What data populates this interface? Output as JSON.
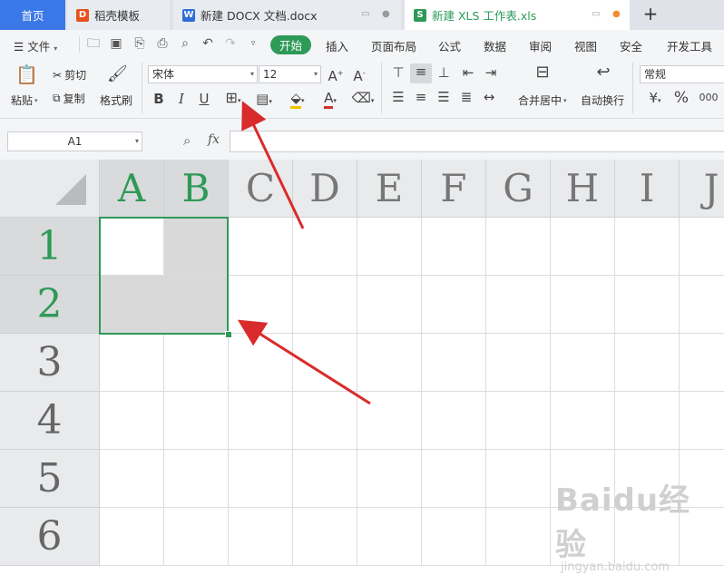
{
  "tabs": {
    "home": "首页",
    "daoke": {
      "label": "稻壳模板"
    },
    "docx": {
      "label": "新建 DOCX 文档.docx"
    },
    "xls": {
      "label": "新建 XLS 工作表.xls"
    },
    "new_tab_icon": "plus-icon"
  },
  "menu": {
    "file": "文件",
    "items": [
      "开始",
      "插入",
      "页面布局",
      "公式",
      "数据",
      "审阅",
      "视图",
      "安全",
      "开发工具"
    ],
    "active": "开始"
  },
  "ribbon": {
    "paste": "粘贴",
    "cut": "剪切",
    "copy": "复制",
    "format_painter": "格式刷",
    "font_name": "宋体",
    "font_size": "12",
    "merge_center": "合并居中",
    "wrap_text": "自动换行",
    "number_format": "常规"
  },
  "formula_bar": {
    "name_box": "A1",
    "fx_label": "fx",
    "formula_value": ""
  },
  "sheet": {
    "columns": [
      "A",
      "B",
      "C",
      "D",
      "E",
      "F",
      "G",
      "H",
      "I",
      "J"
    ],
    "rows": [
      "1",
      "2",
      "3",
      "4",
      "5",
      "6"
    ],
    "selected_range": "A1:B2",
    "active_cell": "A1"
  },
  "colors": {
    "accent_green": "#2e9a57",
    "tab_blue": "#3b78e7",
    "arrow_red": "#d92b2b"
  },
  "watermark": {
    "brand": "Baidu经验",
    "url": "jingyan.baidu.com"
  }
}
